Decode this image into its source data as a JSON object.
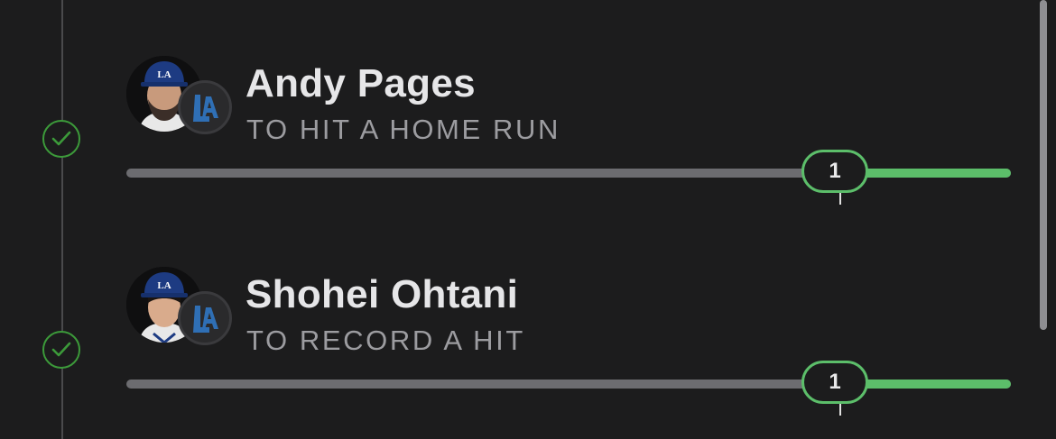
{
  "colors": {
    "background": "#1c1c1d",
    "success_green": "#5cbe6a",
    "check_green": "#3c9a3a",
    "track_gray": "#6c6c70"
  },
  "legs": [
    {
      "player_name": "Andy Pages",
      "prop": "TO HIT A HOME RUN",
      "threshold": "1",
      "progress_fraction": 1.0,
      "status_icon": "checkmark-circle-icon",
      "team_logo_icon": "la-dodgers-logo-icon",
      "avatar_icon": "player-headshot-icon"
    },
    {
      "player_name": "Shohei Ohtani",
      "prop": "TO RECORD A HIT",
      "threshold": "1",
      "progress_fraction": 1.0,
      "status_icon": "checkmark-circle-icon",
      "team_logo_icon": "la-dodgers-logo-icon",
      "avatar_icon": "player-headshot-icon"
    }
  ]
}
